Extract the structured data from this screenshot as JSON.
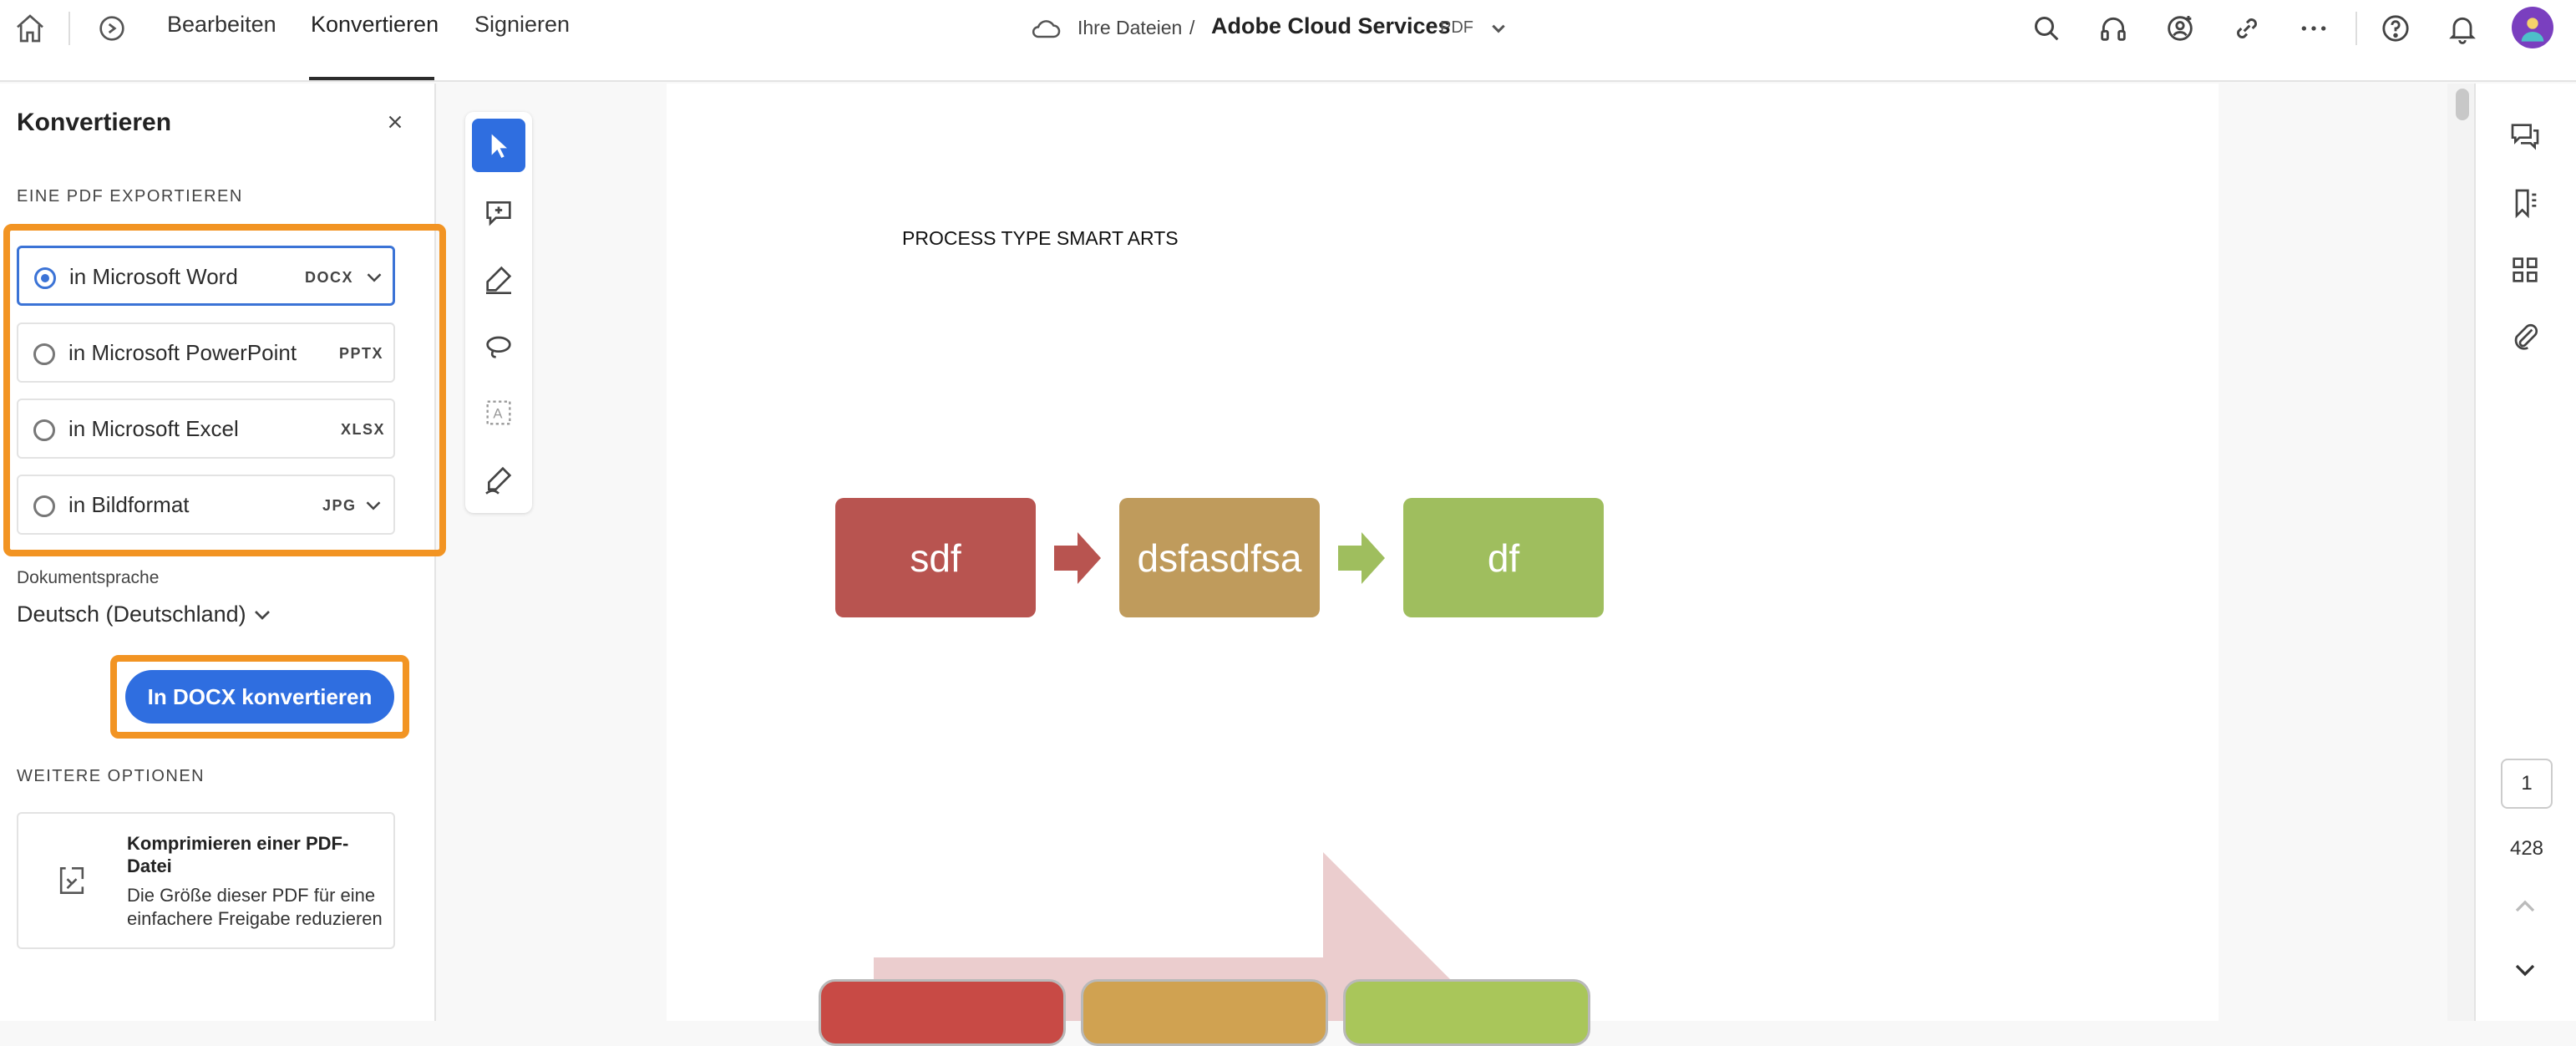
{
  "topbar": {
    "tabs": [
      {
        "label": "Bearbeiten"
      },
      {
        "label": "Konvertieren"
      },
      {
        "label": "Signieren"
      }
    ],
    "breadcrumb": "Ihre Dateien",
    "breadcrumb_separator": "/",
    "doc_title": "Adobe Cloud Services",
    "doc_type": "PDF",
    "icons": [
      "home-icon",
      "history-icon",
      "cloud-icon",
      "chevron-down-icon",
      "search-icon",
      "headphones-icon",
      "add-user-icon",
      "link-icon",
      "more-icon",
      "help-icon",
      "bell-icon",
      "avatar"
    ]
  },
  "panel": {
    "title": "Konvertieren",
    "export_heading": "EINE PDF EXPORTIEREN",
    "options": [
      {
        "label": "in Microsoft Word",
        "format": "DOCX",
        "selected": true
      },
      {
        "label": "in Microsoft PowerPoint",
        "format": "PPTX",
        "selected": false
      },
      {
        "label": "in Microsoft Excel",
        "format": "XLSX",
        "selected": false
      },
      {
        "label": "in Bildformat",
        "format": "JPG",
        "selected": false
      }
    ],
    "language_label": "Dokumentsprache",
    "language_value": "Deutsch (Deutschland)",
    "convert_button": "In DOCX konvertieren",
    "more_heading": "WEITERE OPTIONEN",
    "card": {
      "title": "Komprimieren einer PDF-Datei",
      "description": "Die Größe dieser PDF für eine einfachere Freigabe reduzieren"
    }
  },
  "tools": [
    "select-tool-icon",
    "add-comment-icon",
    "highlight-icon",
    "draw-icon",
    "text-select-icon",
    "sign-icon"
  ],
  "pdf": {
    "heading": "PROCESS TYPE SMART ARTS",
    "process_boxes": [
      {
        "label": "sdf",
        "color": "#b85450"
      },
      {
        "label": "dsfasdfsa",
        "color": "#bf9b5c"
      },
      {
        "label": "df",
        "color": "#9fbe5e"
      }
    ]
  },
  "rightrail": {
    "icons": [
      "comments-icon",
      "bookmarks-icon",
      "thumbnails-icon",
      "attachments-icon"
    ],
    "page_current": "1",
    "page_total": "428"
  },
  "colors": {
    "accent": "#2f6ee0",
    "highlight": "#f29423"
  }
}
